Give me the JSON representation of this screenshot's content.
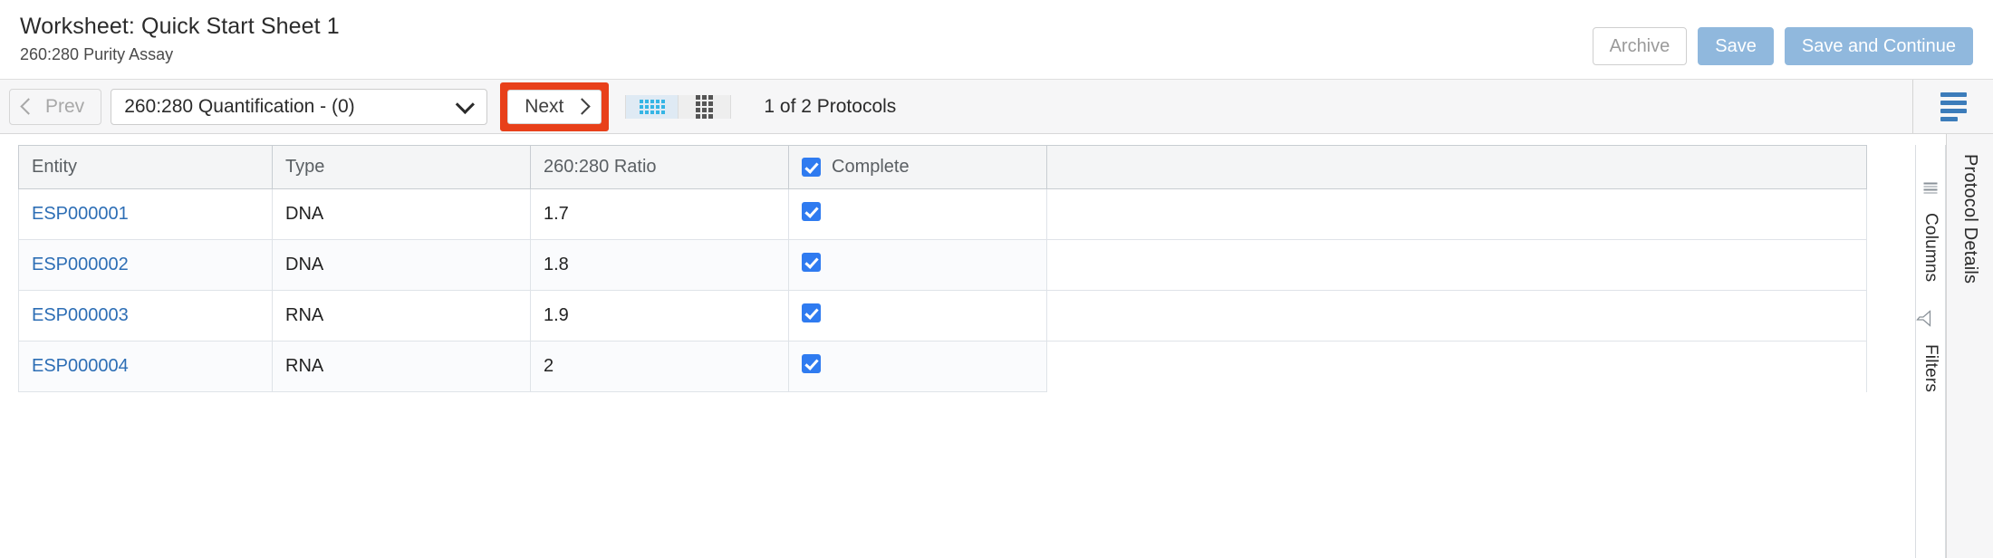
{
  "header": {
    "title": "Worksheet: Quick Start Sheet 1",
    "subtitle": "260:280 Purity Assay",
    "actions": {
      "archive": "Archive",
      "save": "Save",
      "save_and_continue": "Save and Continue"
    },
    "colors": {
      "primary_button": "#90b8dd",
      "archive_border": "#cfcfcf",
      "archive_text": "#9a9a9a"
    }
  },
  "toolbar": {
    "prev_label": "Prev",
    "next_label": "Next",
    "protocol_select_value": "260:280 Quantification - (0)",
    "protocol_count": "1 of 2 Protocols",
    "view_toggles": [
      {
        "icon": "dense-grid-icon",
        "active": true
      },
      {
        "icon": "card-grid-icon",
        "active": false
      }
    ],
    "menu_icon": "list-view-icon",
    "highlight_color": "#e8401a",
    "active_toggle_bg": "#dfeaf4",
    "active_toggle_dot": "#35b5e5"
  },
  "table": {
    "columns": [
      {
        "key": "entity",
        "label": "Entity"
      },
      {
        "key": "type",
        "label": "Type"
      },
      {
        "key": "ratio",
        "label": "260:280 Ratio"
      },
      {
        "key": "complete",
        "label": "Complete",
        "has_checkbox": true,
        "checked": true
      },
      {
        "key": "blank",
        "label": ""
      }
    ],
    "rows": [
      {
        "entity": "ESP000001",
        "type": "DNA",
        "ratio": "1.7",
        "complete": true
      },
      {
        "entity": "ESP000002",
        "type": "DNA",
        "ratio": "1.8",
        "complete": true
      },
      {
        "entity": "ESP000003",
        "type": "RNA",
        "ratio": "1.9",
        "complete": true
      },
      {
        "entity": "ESP000004",
        "type": "RNA",
        "ratio": "2",
        "complete": true
      }
    ],
    "link_color": "#2d6eb5",
    "checkbox_color": "#2f7bf0"
  },
  "right_rail": {
    "columns_label": "Columns",
    "filters_label": "Filters",
    "protocol_details_label": "Protocol Details"
  }
}
